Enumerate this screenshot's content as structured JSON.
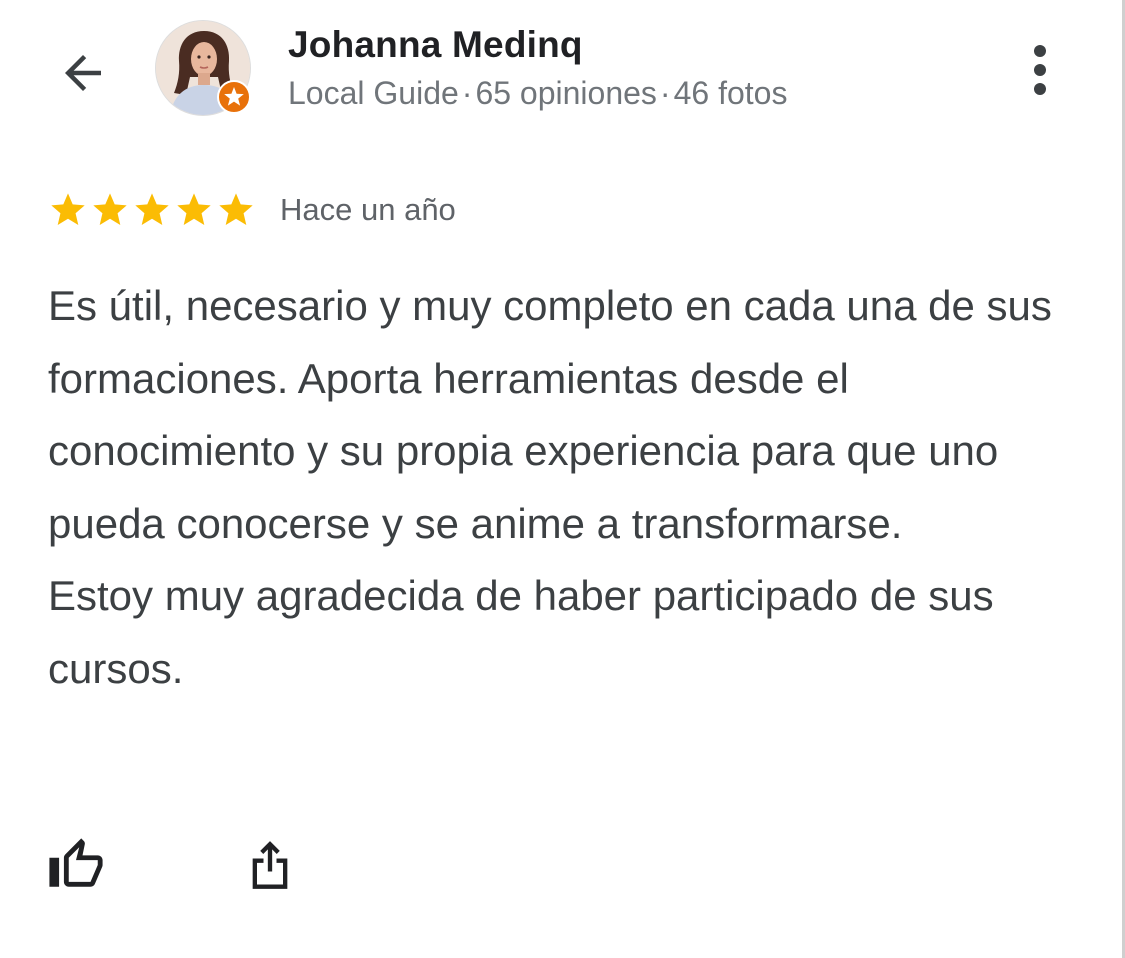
{
  "header": {
    "back_icon": "arrow-back-icon",
    "user_name": "Johanna Medinq",
    "badge": "Local Guide",
    "separator": "·",
    "reviews_count": "65 opiniones",
    "photos_count": "46 fotos",
    "more_icon": "more-vert-icon"
  },
  "review": {
    "rating": 5,
    "rating_max": 5,
    "star_color": "#fbbc04",
    "date": "Hace un año",
    "paragraphs": [
      "Es útil, necesario y muy completo en cada una de sus formaciones. Aporta herramientas desde el conocimiento y su propia experiencia para que uno pueda conocerse y se anime a transformarse.",
      "Estoy muy agradecida de haber participado de sus cursos."
    ]
  },
  "actions": {
    "like_icon": "thumb-up-icon",
    "share_icon": "share-icon"
  },
  "colors": {
    "name": "#202124",
    "meta": "#70757a",
    "body_text": "#3c4043",
    "badge": "#e8710a"
  }
}
